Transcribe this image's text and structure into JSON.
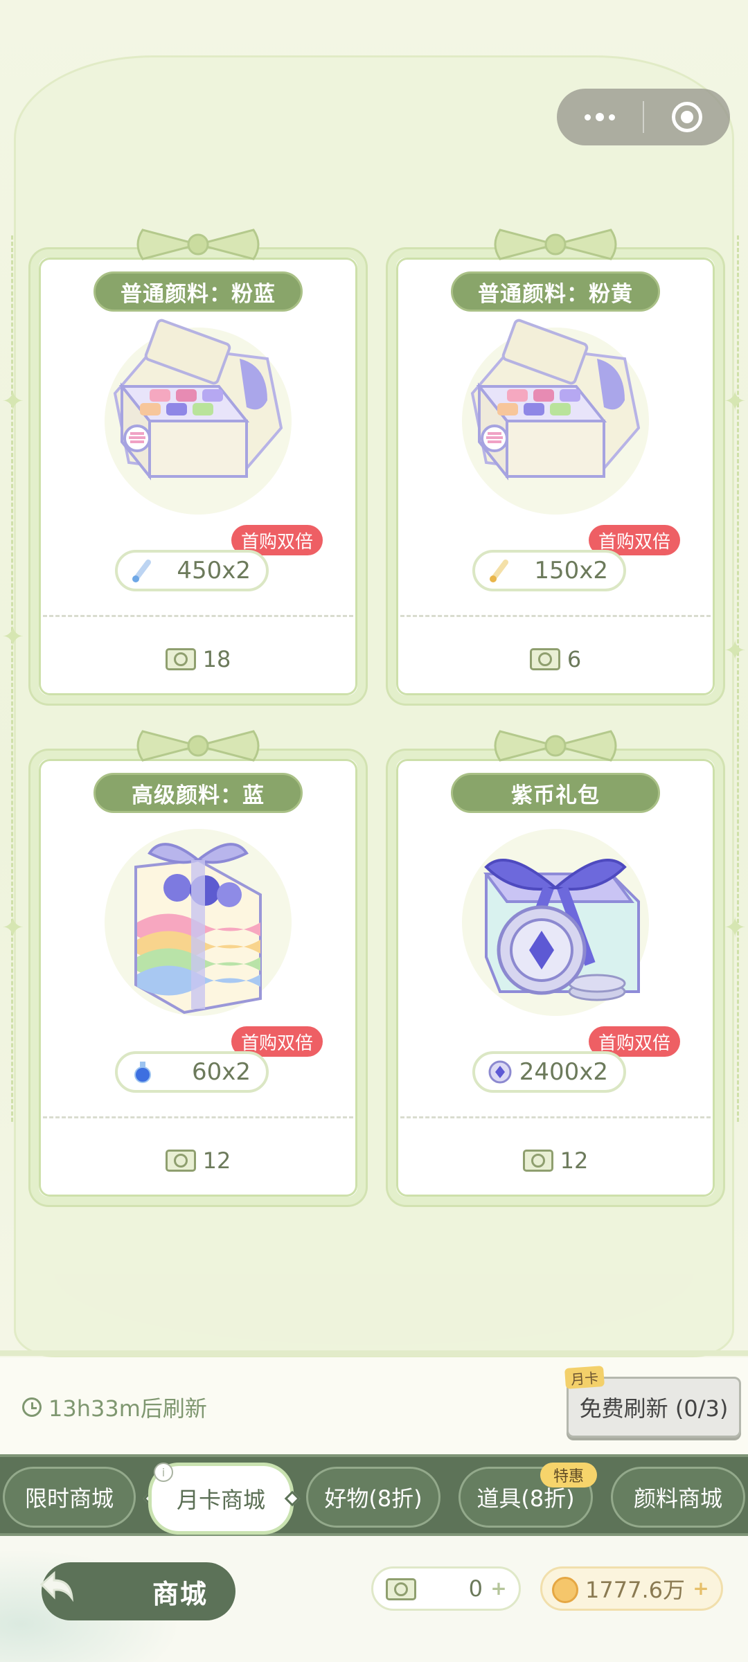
{
  "capsule": {
    "more_icon": "ellipsis-icon",
    "close_icon": "target-icon"
  },
  "products": [
    {
      "title": "普通颜料：粉蓝",
      "icon": "pigment-palette-box-icon",
      "badge": "首购双倍",
      "reward_icon": "pigment-tube-blue-icon",
      "reward": "450x2",
      "cost": "18"
    },
    {
      "title": "普通颜料：粉黄",
      "icon": "pigment-palette-box-icon",
      "badge": "首购双倍",
      "reward_icon": "pigment-tube-yellow-icon",
      "reward": "150x2",
      "cost": "6"
    },
    {
      "title": "高级颜料：蓝",
      "icon": "rainbow-gift-box-icon",
      "badge": "首购双倍",
      "reward_icon": "blue-potion-icon",
      "reward": "60x2",
      "cost": "12"
    },
    {
      "title": "紫币礼包",
      "icon": "purple-coin-gift-icon",
      "badge": "首购双倍",
      "reward_icon": "purple-coin-icon",
      "reward": "2400x2",
      "cost": "12"
    }
  ],
  "refresh": {
    "timer": "13h33m后刷新",
    "tag": "月卡",
    "button": "免费刷新 (0/3)"
  },
  "tabs": [
    {
      "label": "限时商城",
      "active": false
    },
    {
      "label": "月卡商城",
      "active": true
    },
    {
      "label": "好物(8折)",
      "active": false
    },
    {
      "label": "道具(8折)",
      "active": false
    },
    {
      "label": "颜料商城",
      "active": false
    }
  ],
  "tab_info": "i",
  "tab_tag": "特惠",
  "bottom": {
    "title": "商城",
    "cash": "0",
    "gold": "1777.6万"
  },
  "colors": {
    "accent": "#5d7358",
    "badge": "#ee5f64",
    "title_pill": "#89a56a"
  }
}
